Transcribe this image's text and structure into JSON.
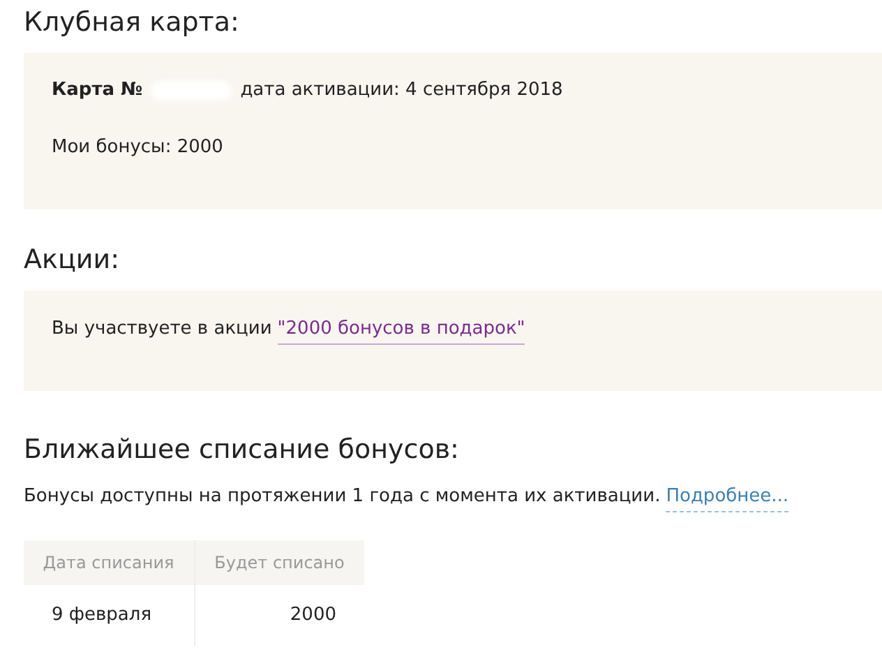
{
  "club_card": {
    "heading": "Клубная карта:",
    "card_label": "Карта №",
    "activation": "дата активации: 4 сентября 2018",
    "bonuses": "Мои бонусы: 2000"
  },
  "promotions": {
    "heading": "Акции:",
    "text": "Вы участвуете в акции",
    "link": "\"2000 бонусов в подарок\""
  },
  "write_off": {
    "heading": "Ближайшее списание бонусов:",
    "note": "Бонусы доступны на протяжении 1 года с момента их активации.",
    "more_link": "Подробнее...",
    "table": {
      "columns": [
        "Дата списания",
        "Будет списано"
      ],
      "rows": [
        [
          "9 февраля",
          "2000"
        ]
      ]
    }
  }
}
